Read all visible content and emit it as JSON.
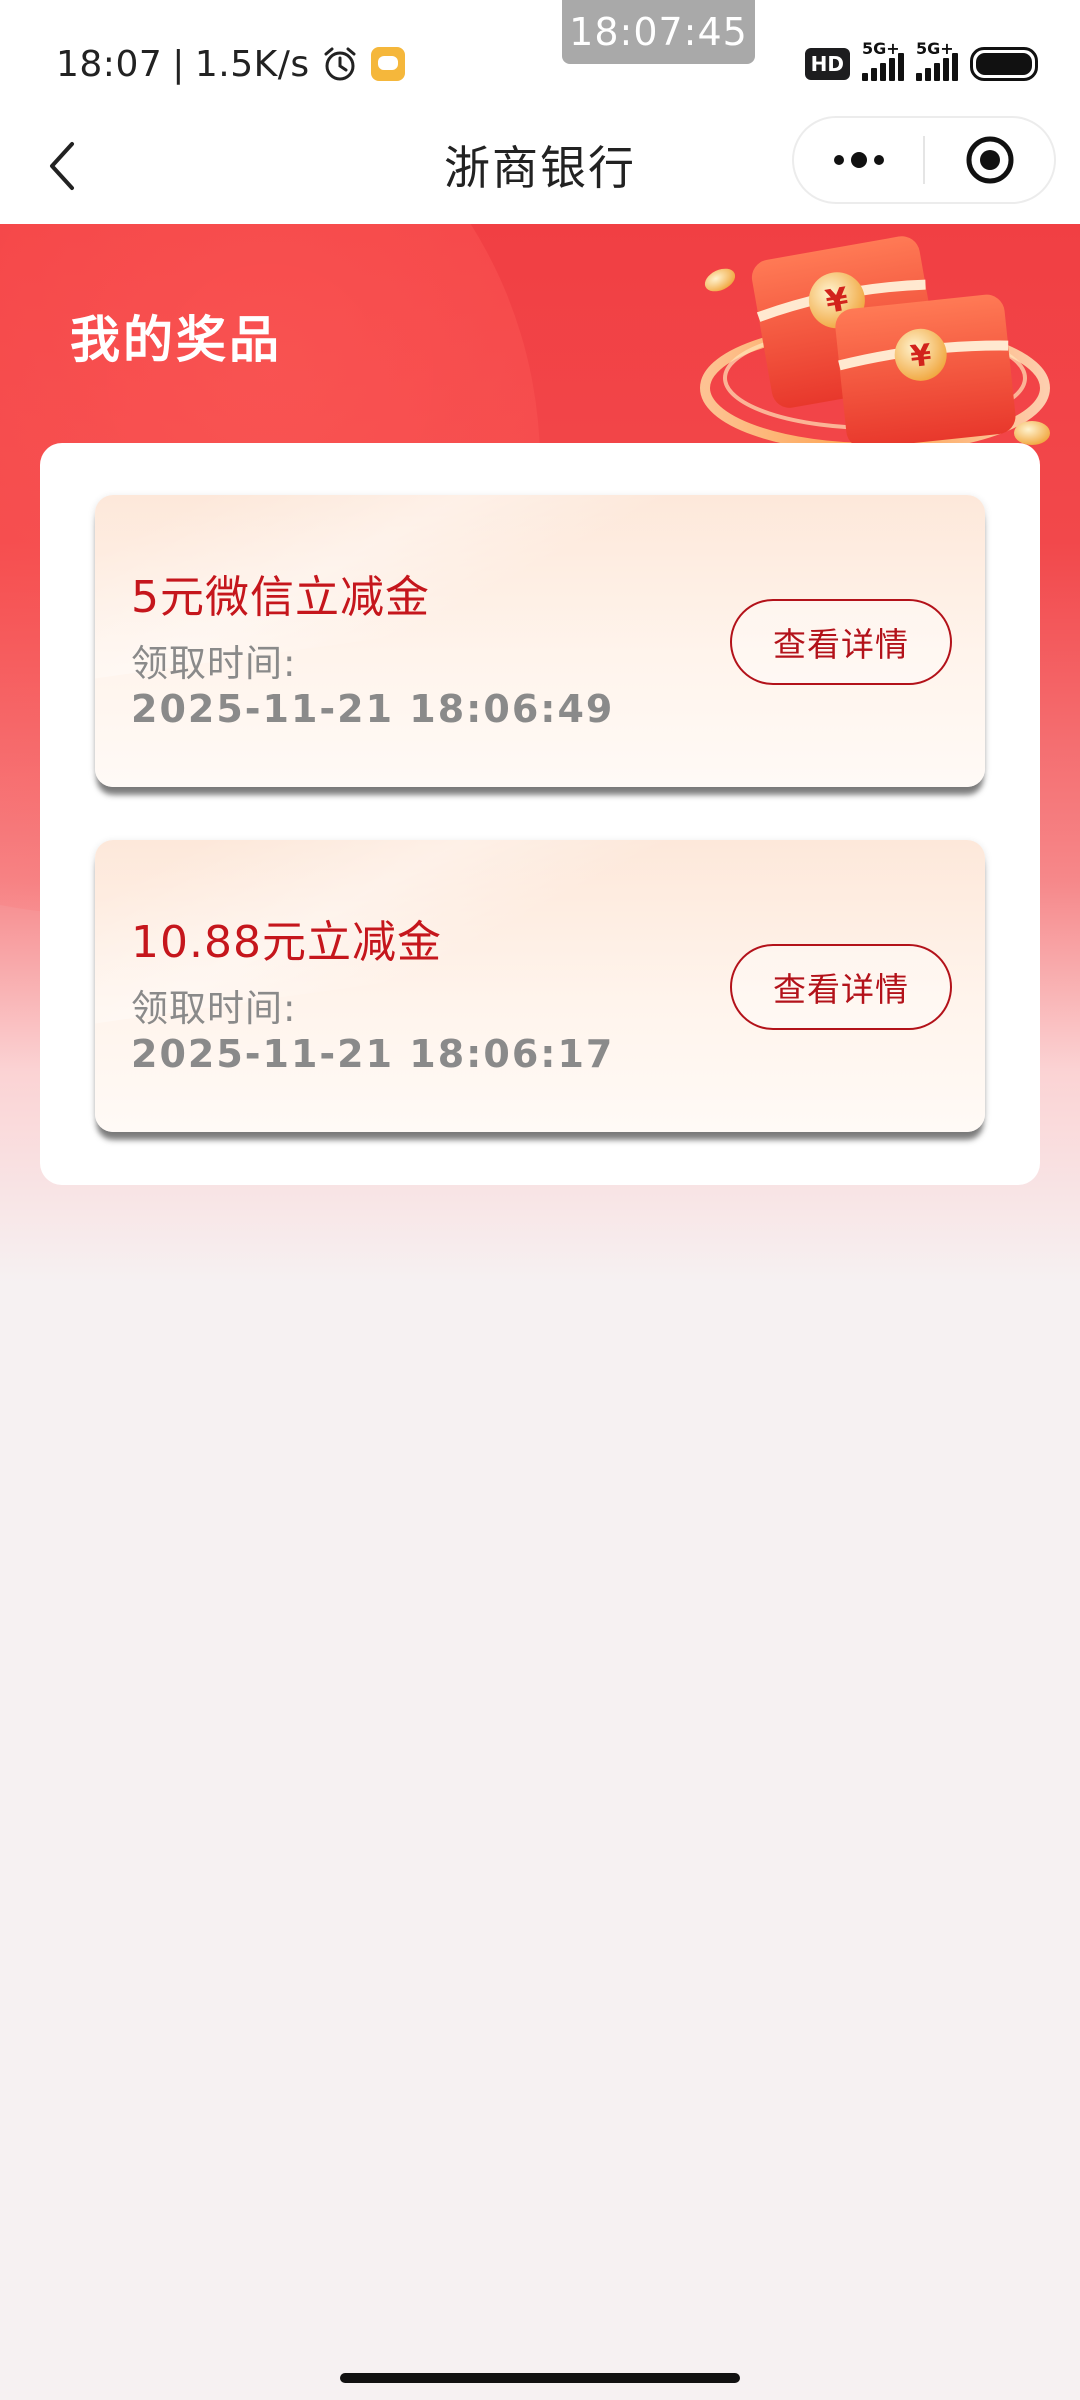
{
  "status_bar": {
    "time": "18:07",
    "network_speed": "1.5K/s",
    "separator": "|",
    "overlay_clock": "18:07:45",
    "hd_badge": "HD",
    "signal1_label": "5G+",
    "signal2_label": "5G+",
    "icons": [
      "alarm-icon",
      "message-icon",
      "hd-icon",
      "signal-icon",
      "signal-icon",
      "battery-icon"
    ]
  },
  "nav": {
    "title": "浙商银行",
    "back_icon": "chevron-left-icon",
    "more_icon": "more-dots-icon",
    "close_icon": "target-circle-icon"
  },
  "hero": {
    "title": "我的奖品"
  },
  "prizes": [
    {
      "name": "5元微信立减金",
      "time_label": "领取时间:",
      "time_value": "2025-11-21 18:06:49",
      "button_label": "查看详情"
    },
    {
      "name": "10.88元立减金",
      "time_label": "领取时间:",
      "time_value": "2025-11-21 18:06:17",
      "button_label": "查看详情"
    }
  ],
  "colors": {
    "brand_red": "#f13f43",
    "prize_text_red": "#c5161c",
    "button_red": "#b3121a",
    "muted_gray": "#8a8a8a"
  }
}
